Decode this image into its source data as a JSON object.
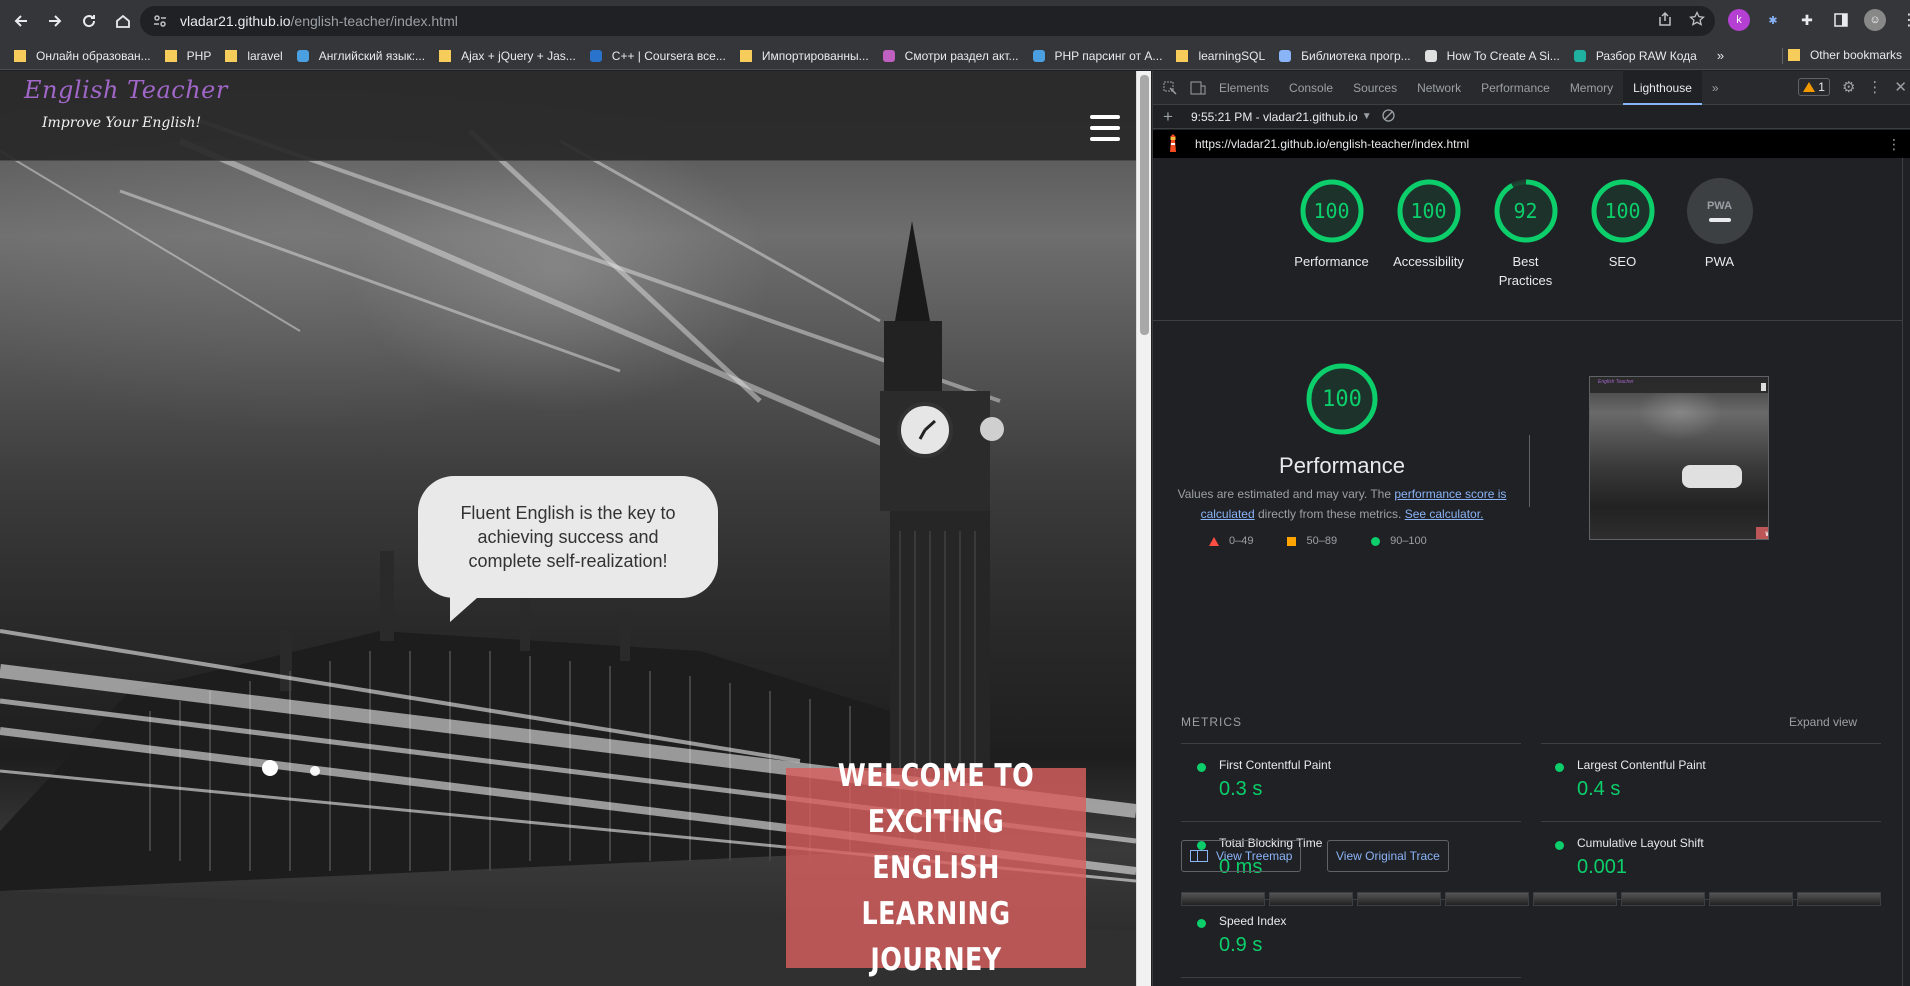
{
  "browser": {
    "url_host": "vladar21.github.io",
    "url_path": "/english-teacher/index.html",
    "bookmarks": [
      {
        "label": "Онлайн образован...",
        "icon": "folder-icon",
        "color": "#f6cc5b"
      },
      {
        "label": "PHP",
        "icon": "folder-icon",
        "color": "#f6cc5b"
      },
      {
        "label": "laravel",
        "icon": "folder-icon",
        "color": "#f6cc5b"
      },
      {
        "label": "Английский язык:...",
        "icon": "site-icon",
        "color": "#4aa0e0"
      },
      {
        "label": "Ajax + jQuery + Jas...",
        "icon": "folder-icon",
        "color": "#f6cc5b"
      },
      {
        "label": "C++ | Coursera все...",
        "icon": "coursera-icon",
        "color": "#2a73cc"
      },
      {
        "label": "Импортированны...",
        "icon": "folder-icon",
        "color": "#f6cc5b"
      },
      {
        "label": "Смотри раздел акт...",
        "icon": "site-icon",
        "color": "#c060c0"
      },
      {
        "label": "PHP парсинг от А...",
        "icon": "site-icon",
        "color": "#4aa0e0"
      },
      {
        "label": "learningSQL",
        "icon": "folder-icon",
        "color": "#f6cc5b"
      },
      {
        "label": "Библиотека прогр...",
        "icon": "site-icon",
        "color": "#8ab4f8"
      },
      {
        "label": "How To Create A Si...",
        "icon": "site-icon",
        "color": "#e0e0e0"
      },
      {
        "label": "Разбор RAW Кода",
        "icon": "site-icon",
        "color": "#20b0a0"
      }
    ],
    "bookmarks_more": "»",
    "other_bookmarks": "Other bookmarks"
  },
  "page": {
    "site_title": "English Teacher",
    "site_subtitle": "Improve Your English!",
    "bubble_text": "Fluent English is the key to achieving success and complete self-realization!",
    "welcome_line1": "WELCOME TO",
    "welcome_line2": "EXCITING ENGLISH",
    "welcome_line3": "LEARNING JOURNEY"
  },
  "devtools": {
    "tabs": [
      "Elements",
      "Console",
      "Sources",
      "Network",
      "Performance",
      "Memory",
      "Lighthouse"
    ],
    "active_tab": "Lighthouse",
    "more_tabs": "»",
    "warning_count": "1",
    "report_label": "9:55:21 PM - vladar21.github.io",
    "lighthouse_url": "https://vladar21.github.io/english-teacher/index.html"
  },
  "lighthouse": {
    "gauges": [
      {
        "label": "Performance",
        "score": "100",
        "fraction": 1.0
      },
      {
        "label": "Accessibility",
        "score": "100",
        "fraction": 1.0
      },
      {
        "label": "Best",
        "label2": "Practices",
        "score": "92",
        "fraction": 0.92
      },
      {
        "label": "SEO",
        "score": "100",
        "fraction": 1.0
      }
    ],
    "pwa_label": "PWA",
    "pwa_badge": "PWA",
    "perf_score": "100",
    "perf_title": "Performance",
    "desc_part1": "Values are estimated and may vary. The ",
    "desc_link1": "performance score is calculated",
    "desc_part2": " directly from these metrics. ",
    "desc_link2": "See calculator.",
    "legend": [
      "0–49",
      "50–89",
      "90–100"
    ],
    "thumb_title": "English Teacher",
    "thumb_welcome": "WELCOME TO EXCITING ENGLISH LEARNING JOURNEY",
    "metrics_heading": "METRICS",
    "expand_view": "Expand view",
    "metrics": [
      {
        "name": "First Contentful Paint",
        "value": "0.3 s"
      },
      {
        "name": "Largest Contentful Paint",
        "value": "0.4 s"
      },
      {
        "name": "Total Blocking Time",
        "value": "0 ms"
      },
      {
        "name": "Cumulative Layout Shift",
        "value": "0.001"
      },
      {
        "name": "Speed Index",
        "value": "0.9 s"
      }
    ],
    "view_treemap": "View Treemap",
    "view_trace": "View Original Trace"
  },
  "colors": {
    "pass_green": "#0cce6b",
    "welcome_bg": "#d75f5f",
    "title_purple": "#a066c8"
  }
}
